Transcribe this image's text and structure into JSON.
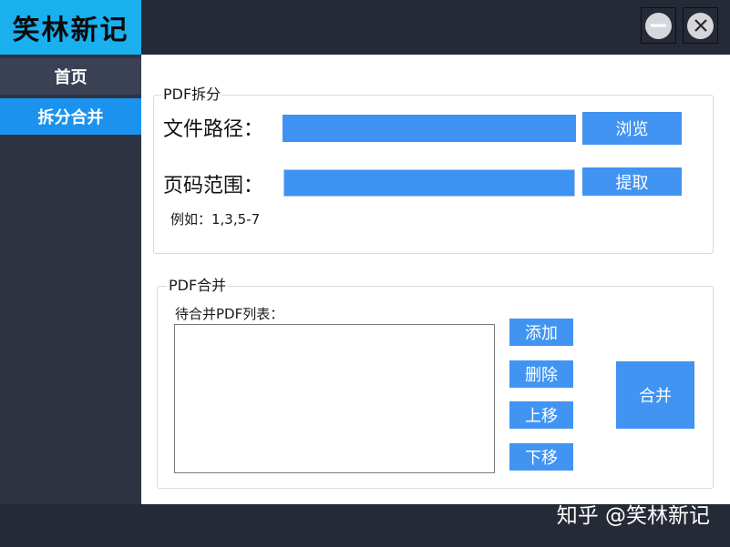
{
  "app": {
    "logo_text": "笑林新记"
  },
  "window_controls": {
    "minimize_icon": "minus-circle-icon",
    "close_icon": "x-circle-icon"
  },
  "sidebar": {
    "items": [
      {
        "label": "首页",
        "selected": false
      },
      {
        "label": "拆分合并",
        "selected": true
      }
    ]
  },
  "split": {
    "legend": "PDF拆分",
    "path_label": "文件路径：",
    "path_value": "",
    "browse_label": "浏览",
    "pages_label": "页码范围：",
    "pages_value": "",
    "extract_label": "提取",
    "hint": "例如：1,3,5-7"
  },
  "merge": {
    "legend": "PDF合并",
    "list_label": "待合并PDF列表：",
    "list_items": [],
    "add_label": "添加",
    "delete_label": "删除",
    "up_label": "上移",
    "down_label": "下移",
    "merge_label": "合并"
  },
  "watermark": "知乎 @笑林新记",
  "colors": {
    "brand": "#1ab0f0",
    "accent": "#4194f2",
    "chrome": "#252a36",
    "sidebar": "#2e3342",
    "nav_selected": "#1b93ee"
  }
}
